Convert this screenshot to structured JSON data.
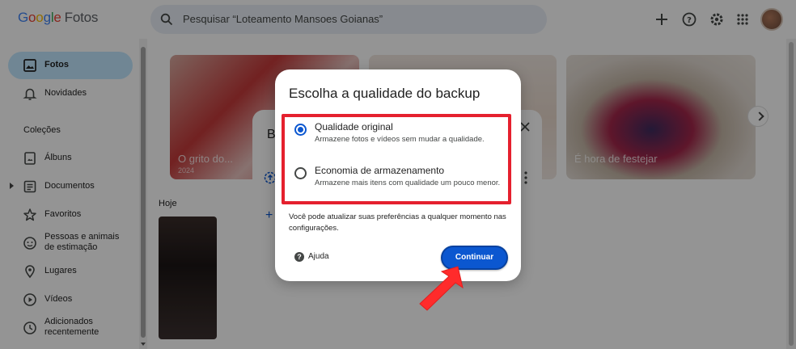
{
  "app": {
    "logo_google": [
      "G",
      "o",
      "o",
      "g",
      "l",
      "e"
    ],
    "product_name": "Fotos"
  },
  "search": {
    "placeholder": "Pesquisar “Loteamento Mansoes Goianas”"
  },
  "header_icons": [
    "plus-icon",
    "help-icon",
    "settings-icon",
    "apps-grid-icon"
  ],
  "sidebar": {
    "items_top": [
      {
        "label": "Fotos",
        "icon": "photo-icon",
        "active": true
      },
      {
        "label": "Novidades",
        "icon": "bell-icon",
        "active": false
      }
    ],
    "section_title": "Coleções",
    "items_collections": [
      {
        "label": "Álbuns",
        "icon": "album-icon"
      },
      {
        "label": "Documentos",
        "icon": "document-icon"
      },
      {
        "label": "Favoritos",
        "icon": "star-icon"
      },
      {
        "label": "Pessoas e animais de estimação",
        "icon": "face-icon"
      },
      {
        "label": "Lugares",
        "icon": "location-icon"
      },
      {
        "label": "Vídeos",
        "icon": "play-icon"
      },
      {
        "label": "Adicionados recentemente",
        "icon": "clock-icon"
      }
    ]
  },
  "main": {
    "memories": [
      {
        "caption": "O grito do...",
        "sub": "2024"
      },
      {
        "caption": "",
        "sub": ""
      },
      {
        "caption": "É hora de festejar",
        "sub": ""
      }
    ],
    "today_label": "Hoje"
  },
  "background_dialog": {
    "title_initial": "B",
    "plus": "+"
  },
  "dialog": {
    "title": "Escolha a qualidade do backup",
    "options": [
      {
        "label": "Qualidade original",
        "description": "Armazene fotos e vídeos sem mudar a qualidade.",
        "selected": true
      },
      {
        "label": "Economia de armazenamento",
        "description": "Armazene mais itens com qualidade um pouco menor.",
        "selected": false
      }
    ],
    "note": "Você pode atualizar suas preferências a qualquer momento nas configurações.",
    "help_label": "Ajuda",
    "continue_label": "Continuar"
  },
  "colors": {
    "accent": "#0b57d0",
    "highlight_border": "#e5202e",
    "active_nav": "#c2e7ff"
  }
}
